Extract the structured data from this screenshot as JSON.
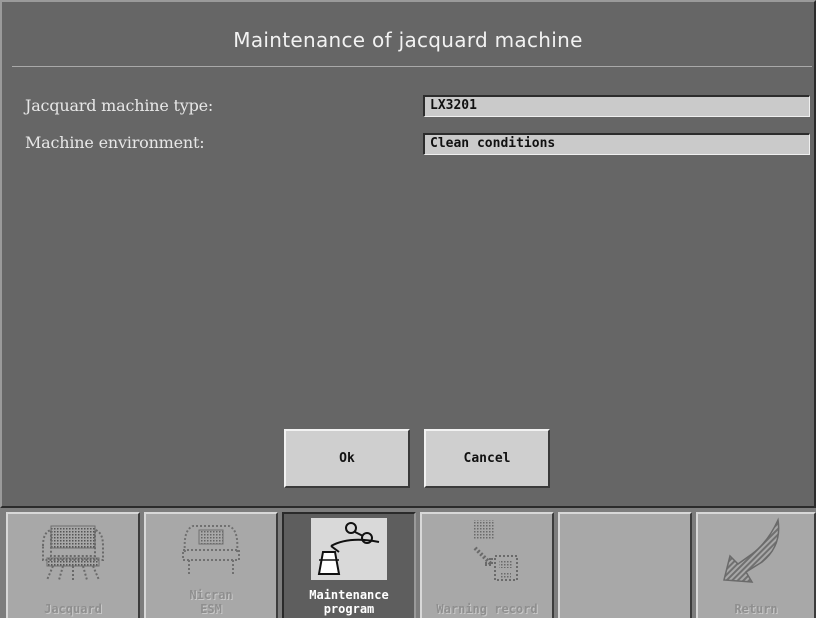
{
  "dialog": {
    "title": "Maintenance of  jacquard machine",
    "fields": [
      {
        "label": "Jacquard machine type:",
        "value": "LX3201"
      },
      {
        "label": "Machine environment:",
        "value": "Clean conditions"
      }
    ],
    "ok_label": "Ok",
    "cancel_label": "Cancel"
  },
  "toolbar": {
    "items": [
      {
        "label": "Jacquard",
        "icon": "jacquard-machine-icon",
        "state": "disabled"
      },
      {
        "label": "Nicran\nESM",
        "icon": "nicran-esm-icon",
        "state": "disabled"
      },
      {
        "label": "Maintenance\nprogram",
        "icon": "oil-can-icon",
        "state": "active"
      },
      {
        "label": "Warning record",
        "icon": "warning-record-icon",
        "state": "disabled"
      },
      {
        "label": "",
        "icon": "",
        "state": "empty"
      },
      {
        "label": "Return",
        "icon": "return-arrow-icon",
        "state": "disabled"
      }
    ]
  },
  "colors": {
    "dialog_background": "#666666",
    "field_background": "#cacaca",
    "button_background": "#cfcfcf",
    "toolbar_background": "#a8a8a8",
    "active_tool_background": "#5e5e5e"
  }
}
